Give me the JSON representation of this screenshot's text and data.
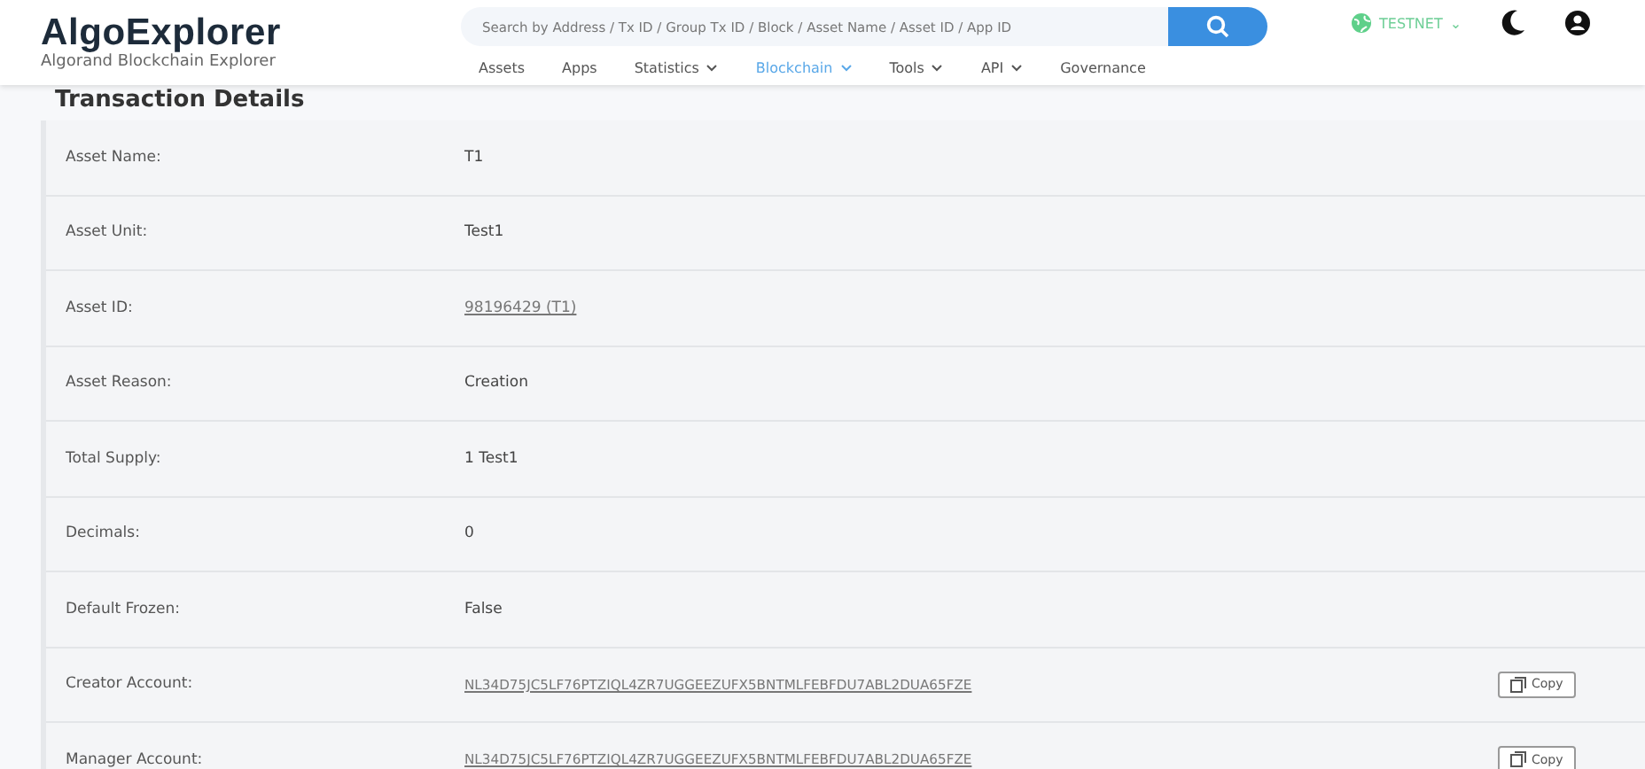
{
  "logo": {
    "title": "AlgoExplorer",
    "subtitle": "Algorand Blockchain Explorer"
  },
  "search": {
    "placeholder": "Search by Address / Tx ID / Group Tx ID / Block / Asset Name / Asset ID / App ID"
  },
  "network": {
    "label": "TESTNET",
    "caret": "⌄"
  },
  "nav": [
    {
      "label": "Assets",
      "dropdown": false,
      "selected": false
    },
    {
      "label": "Apps",
      "dropdown": false,
      "selected": false
    },
    {
      "label": "Statistics",
      "dropdown": true,
      "selected": false
    },
    {
      "label": "Blockchain",
      "dropdown": true,
      "selected": true
    },
    {
      "label": "Tools",
      "dropdown": true,
      "selected": false
    },
    {
      "label": "API",
      "dropdown": true,
      "selected": false
    },
    {
      "label": "Governance",
      "dropdown": false,
      "selected": false
    }
  ],
  "page_title": "Transaction Details",
  "rows": [
    {
      "label": "Asset Name:",
      "value": "T1",
      "kind": "text"
    },
    {
      "label": "Asset Unit:",
      "value": "Test1",
      "kind": "text"
    },
    {
      "label": "Asset ID:",
      "value": "98196429 (T1)",
      "kind": "link"
    },
    {
      "label": "Asset Reason:",
      "value": "Creation",
      "kind": "text"
    },
    {
      "label": "Total Supply:",
      "value": "1 Test1",
      "kind": "text"
    },
    {
      "label": "Decimals:",
      "value": "0",
      "kind": "text"
    },
    {
      "label": "Default Frozen:",
      "value": "False",
      "kind": "text"
    },
    {
      "label": "Creator Account:",
      "value": "NL34D75JC5LF76PTZIQL4ZR7UGGEEZUFX5BNTMLFEBFDU7ABL2DUA65FZE",
      "kind": "account",
      "button": "Copy"
    },
    {
      "label": "Manager Account:",
      "value": "NL34D75JC5LF76PTZIQL4ZR7UGGEEZUFX5BNTMLFEBFDU7ABL2DUA65FZE",
      "kind": "account",
      "button": "Copy"
    }
  ]
}
